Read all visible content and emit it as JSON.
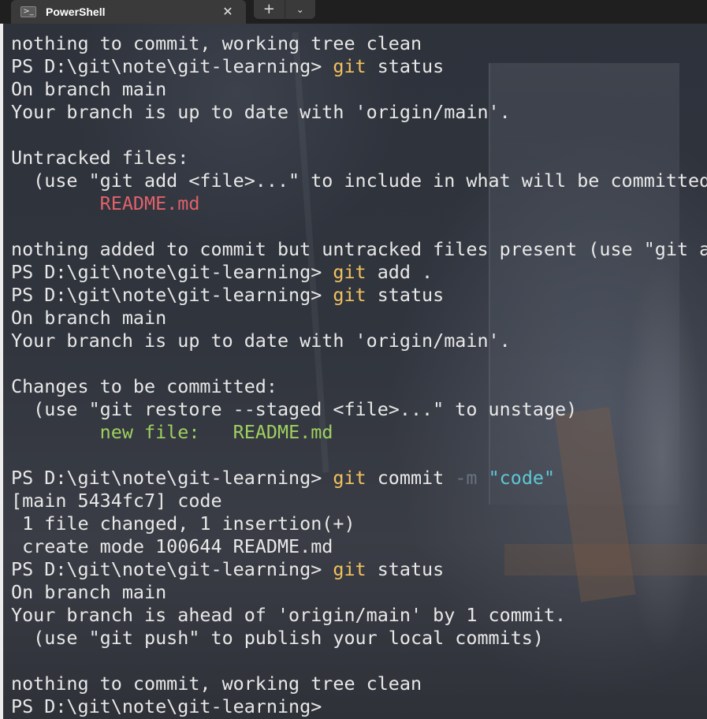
{
  "window": {
    "tab_title": "PowerShell",
    "tab_icon": "powershell-icon",
    "close_icon": "close-icon",
    "newtab_icon": "plus-icon",
    "dropdown_icon": "chevron-down-icon"
  },
  "colors": {
    "command": "#f3c25f",
    "flag": "#6a7380",
    "string": "#5ec8d6",
    "untracked": "#e0626b",
    "staged": "#9fd060",
    "text": "#e8e8e8"
  },
  "terminal": {
    "lines": [
      [
        {
          "t": "nothing to commit, working tree clean",
          "c": ""
        }
      ],
      [
        {
          "t": "PS D:\\git\\note\\git-learning> ",
          "c": ""
        },
        {
          "t": "git",
          "c": "cmd"
        },
        {
          "t": " status",
          "c": ""
        }
      ],
      [
        {
          "t": "On branch main",
          "c": ""
        }
      ],
      [
        {
          "t": "Your branch is up to date with 'origin/main'.",
          "c": ""
        }
      ],
      [
        {
          "t": "",
          "c": ""
        }
      ],
      [
        {
          "t": "Untracked files:",
          "c": ""
        }
      ],
      [
        {
          "t": "  (use \"git add <file>...\" to include in what will be committed)",
          "c": ""
        }
      ],
      [
        {
          "t": "        ",
          "c": ""
        },
        {
          "t": "README.md",
          "c": "untracked"
        }
      ],
      [
        {
          "t": "",
          "c": ""
        }
      ],
      [
        {
          "t": "nothing added to commit but untracked files present (use \"git add\" to track)",
          "c": ""
        }
      ],
      [
        {
          "t": "PS D:\\git\\note\\git-learning> ",
          "c": ""
        },
        {
          "t": "git",
          "c": "cmd"
        },
        {
          "t": " add .",
          "c": ""
        }
      ],
      [
        {
          "t": "PS D:\\git\\note\\git-learning> ",
          "c": ""
        },
        {
          "t": "git",
          "c": "cmd"
        },
        {
          "t": " status",
          "c": ""
        }
      ],
      [
        {
          "t": "On branch main",
          "c": ""
        }
      ],
      [
        {
          "t": "Your branch is up to date with 'origin/main'.",
          "c": ""
        }
      ],
      [
        {
          "t": "",
          "c": ""
        }
      ],
      [
        {
          "t": "Changes to be committed:",
          "c": ""
        }
      ],
      [
        {
          "t": "  (use \"git restore --staged <file>...\" to unstage)",
          "c": ""
        }
      ],
      [
        {
          "t": "        ",
          "c": ""
        },
        {
          "t": "new file:   README.md",
          "c": "staged"
        }
      ],
      [
        {
          "t": "",
          "c": ""
        }
      ],
      [
        {
          "t": "PS D:\\git\\note\\git-learning> ",
          "c": ""
        },
        {
          "t": "git",
          "c": "cmd"
        },
        {
          "t": " commit ",
          "c": ""
        },
        {
          "t": "-m",
          "c": "flag"
        },
        {
          "t": " ",
          "c": ""
        },
        {
          "t": "\"code\"",
          "c": "str"
        }
      ],
      [
        {
          "t": "[main 5434fc7] code",
          "c": ""
        }
      ],
      [
        {
          "t": " 1 file changed, 1 insertion(+)",
          "c": ""
        }
      ],
      [
        {
          "t": " create mode 100644 README.md",
          "c": ""
        }
      ],
      [
        {
          "t": "PS D:\\git\\note\\git-learning> ",
          "c": ""
        },
        {
          "t": "git",
          "c": "cmd"
        },
        {
          "t": " status",
          "c": ""
        }
      ],
      [
        {
          "t": "On branch main",
          "c": ""
        }
      ],
      [
        {
          "t": "Your branch is ahead of 'origin/main' by 1 commit.",
          "c": ""
        }
      ],
      [
        {
          "t": "  (use \"git push\" to publish your local commits)",
          "c": ""
        }
      ],
      [
        {
          "t": "",
          "c": ""
        }
      ],
      [
        {
          "t": "nothing to commit, working tree clean",
          "c": ""
        }
      ],
      [
        {
          "t": "PS D:\\git\\note\\git-learning>",
          "c": ""
        }
      ]
    ]
  }
}
